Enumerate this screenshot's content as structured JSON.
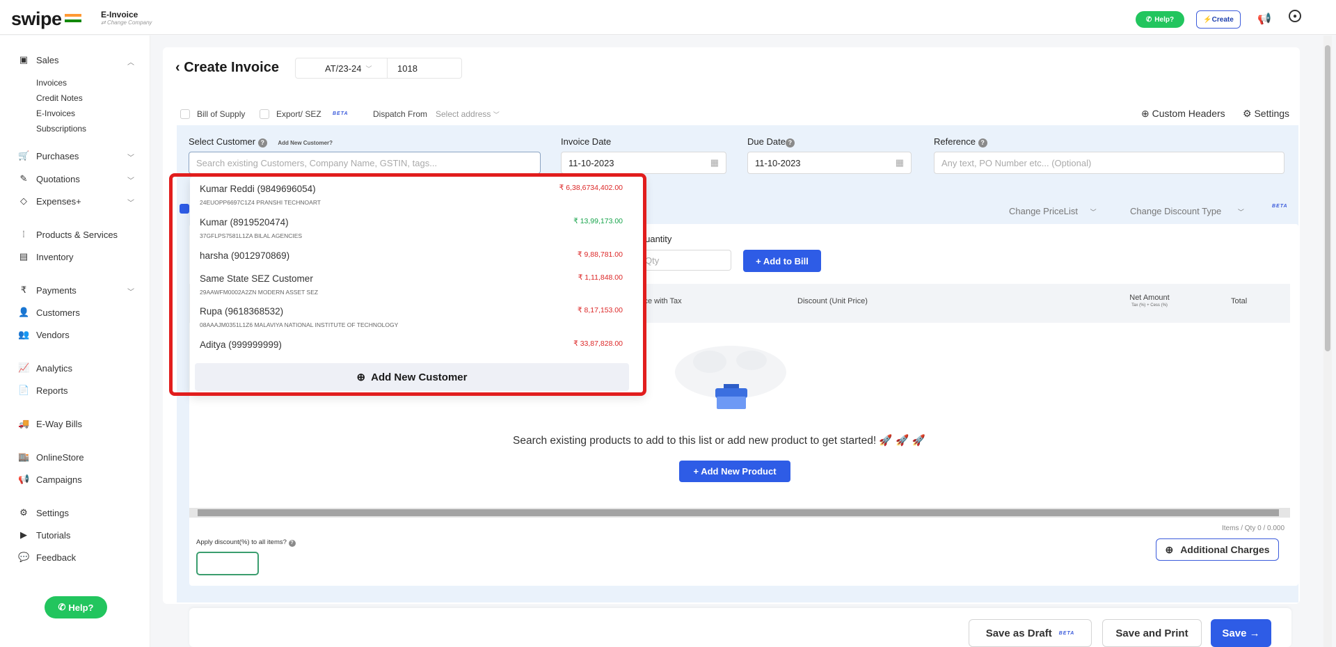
{
  "app": {
    "logo": "swipe",
    "module": "E-Invoice",
    "change_company": "Change Company",
    "help": "Help?",
    "create": "Create"
  },
  "sidebar": {
    "sales": "Sales",
    "sales_sub": [
      "Invoices",
      "Credit Notes",
      "E-Invoices",
      "Subscriptions"
    ],
    "purchases": "Purchases",
    "quotations": "Quotations",
    "expenses": "Expenses+",
    "products": "Products & Services",
    "inventory": "Inventory",
    "payments": "Payments",
    "customers": "Customers",
    "vendors": "Vendors",
    "analytics": "Analytics",
    "reports": "Reports",
    "eway": "E-Way Bills",
    "onlinestore": "OnlineStore",
    "campaigns": "Campaigns",
    "settings": "Settings",
    "tutorials": "Tutorials",
    "feedback": "Feedback",
    "help": "Help?"
  },
  "header": {
    "title": "Create Invoice",
    "prefix": "AT/23-24",
    "number": "1018"
  },
  "options": {
    "bill_of_supply": "Bill of Supply",
    "export_sez": "Export/ SEZ",
    "beta": "BETA",
    "dispatch_from": "Dispatch From",
    "select_address": "Select address",
    "custom_headers": "Custom Headers",
    "settings": "Settings"
  },
  "form": {
    "select_customer": "Select Customer",
    "add_new_customer_link": "Add New Customer?",
    "customer_placeholder": "Search existing Customers, Company Name, GSTIN, tags...",
    "invoice_date_label": "Invoice Date",
    "invoice_date": "11-10-2023",
    "due_date_label": "Due Date",
    "due_date": "11-10-2023",
    "reference_label": "Reference",
    "reference_placeholder": "Any text, PO Number etc... (Optional)"
  },
  "items": {
    "change_pricelist": "Change PriceList",
    "change_discount": "Change Discount Type",
    "beta": "BETA",
    "quantity_label": "Quantity",
    "qty_placeholder": "Qty",
    "add_to_bill": "+ Add to Bill",
    "col_price": "Price with Tax",
    "col_discount": "Discount (Unit Price)",
    "col_net": "Net Amount",
    "col_net_sub": "Tax (%) + Cess (%)",
    "col_total": "Total",
    "empty_text": "Search existing products to add to this list or add new product to get started! 🚀 🚀 🚀",
    "add_new_product": "+ Add New Product",
    "items_qty": "Items / Qty 0 / 0.000",
    "apply_discount": "Apply discount(%) to all items?",
    "additional_charges": "Additional Charges"
  },
  "dropdown": {
    "customers": [
      {
        "name": "Kumar Reddi (9849696054)",
        "sub": "24EUOPP6697C1Z4 PRANSHI TECHNOART",
        "amount": "₹ 6,38,6734,402.00",
        "color": "#dc2626"
      },
      {
        "name": "Kumar (8919520474)",
        "sub": "37GFLPS7581L1ZA BILAL AGENCIES",
        "amount": "₹ 13,99,173.00",
        "color": "#16a34a"
      },
      {
        "name": "harsha (9012970869)",
        "sub": "",
        "amount": "₹ 9,88,781.00",
        "color": "#dc2626"
      },
      {
        "name": "Same State SEZ Customer",
        "sub": "29AAWFM0002A2ZN MODERN ASSET SEZ",
        "amount": "₹ 1,11,848.00",
        "color": "#dc2626"
      },
      {
        "name": "Rupa (9618368532)",
        "sub": "08AAAJM0351L1Z6 MALAVIYA NATIONAL INSTITUTE OF TECHNOLOGY",
        "amount": "₹ 8,17,153.00",
        "color": "#dc2626"
      },
      {
        "name": "Aditya (999999999)",
        "sub": "",
        "amount": "₹ 33,87,828.00",
        "color": "#dc2626"
      }
    ],
    "add_new": "Add New Customer"
  },
  "footer": {
    "save_draft": "Save as Draft",
    "beta": "BETA",
    "save_print": "Save and Print",
    "save": "Save →"
  }
}
